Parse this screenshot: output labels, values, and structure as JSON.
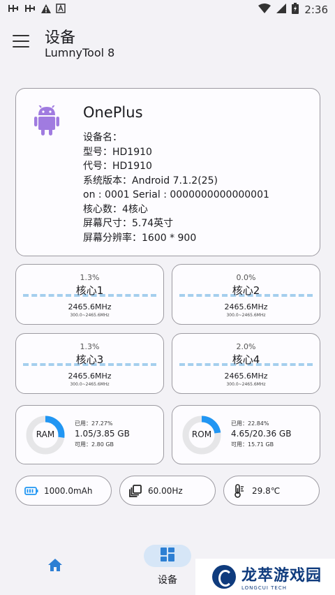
{
  "status_bar": {
    "time": "2:36",
    "left_icons": [
      "bug-icon",
      "bug-icon",
      "warning-icon",
      "notification-a-icon"
    ],
    "right_icons": [
      "wifi-icon",
      "signal-icon",
      "battery-charging-icon"
    ]
  },
  "app_bar": {
    "title": "设备",
    "subtitle": "LumnyTool 8"
  },
  "device_info": {
    "brand": "OnePlus",
    "lines": [
      "设备名：",
      "型号：HD1910",
      "代号：HD1910",
      "系统版本：Android 7.1.2(25)",
      "on : 0001 Serial   : 0000000000000001",
      "核心数：4核心",
      "屏幕尺寸：5.74英寸",
      "屏幕分辨率：1600 * 900"
    ]
  },
  "cores": [
    {
      "usage": "1.3%",
      "name": "核心1",
      "freq": "2465.6MHz",
      "range": "300.0~2465.6MHz"
    },
    {
      "usage": "0.0%",
      "name": "核心2",
      "freq": "2465.6MHz",
      "range": "300.0~2465.6MHz"
    },
    {
      "usage": "1.3%",
      "name": "核心3",
      "freq": "2465.6MHz",
      "range": "300.0~2465.6MHz"
    },
    {
      "usage": "2.0%",
      "name": "核心4",
      "freq": "2465.6MHz",
      "range": "300.0~2465.6MHz"
    }
  ],
  "memory": {
    "ram": {
      "label": "RAM",
      "used": "已用：27.27%",
      "amount": "1.05/3.85 GB",
      "available": "可用：2.80 GB",
      "fraction": 0.2727
    },
    "rom": {
      "label": "ROM",
      "used": "已用：22.84%",
      "amount": "4.65/20.36 GB",
      "available": "可用：15.71 GB",
      "fraction": 0.2284
    }
  },
  "pills": {
    "battery": "1000.0mAh",
    "refresh": "60.00Hz",
    "temperature": "29.8℃"
  },
  "nav": {
    "active_label": "设备"
  },
  "watermark": {
    "main": "龙萃游戏园",
    "sub": "LONGCUI TECH"
  },
  "colors": {
    "accent": "#2196f3",
    "ring_track": "#e6e6e8",
    "dash": "#a5cfee",
    "android": "#a07be0"
  }
}
